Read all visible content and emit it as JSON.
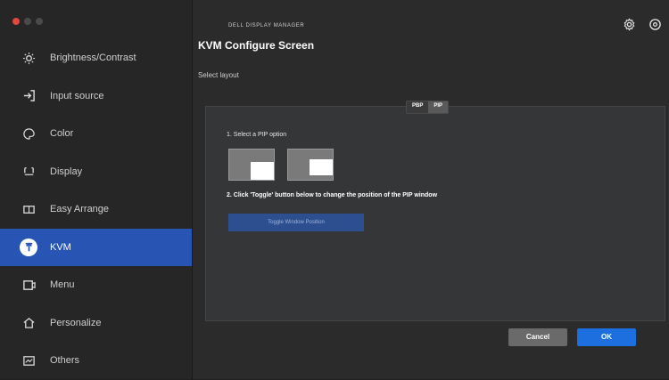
{
  "window": {
    "traffic_colors": [
      "#e0493c",
      "#4a4a4a",
      "#4a4a4a"
    ]
  },
  "sidebar": {
    "items": [
      {
        "label": "Brightness/Contrast",
        "icon": "sun-icon"
      },
      {
        "label": "Input source",
        "icon": "input-arrow-icon"
      },
      {
        "label": "Color",
        "icon": "color-palette-icon"
      },
      {
        "label": "Display",
        "icon": "monitor-icon"
      },
      {
        "label": "Easy Arrange",
        "icon": "layout-grid-icon"
      },
      {
        "label": "KVM",
        "icon": "kvm-icon",
        "active": true
      },
      {
        "label": "Menu",
        "icon": "menu-icon"
      },
      {
        "label": "Personalize",
        "icon": "home-star-icon"
      },
      {
        "label": "Others",
        "icon": "others-icon"
      }
    ]
  },
  "header": {
    "app_label": "DELL DISPLAY MANAGER",
    "title": "KVM Configure Screen",
    "subtitle": "Select layout"
  },
  "panel": {
    "segments": [
      "PBP",
      "PIP"
    ],
    "active_segment": "PIP",
    "step1": "1. Select a PIP option",
    "step2": "2. Click 'Toggle' button below to change the position of the PIP window",
    "toggle_label": "Toggle Window Position"
  },
  "footer": {
    "cancel_label": "Cancel",
    "ok_label": "OK"
  },
  "colors": {
    "accent": "#2854b4",
    "ok_button": "#1d6fe0",
    "cancel_button": "#6a6a6a"
  }
}
